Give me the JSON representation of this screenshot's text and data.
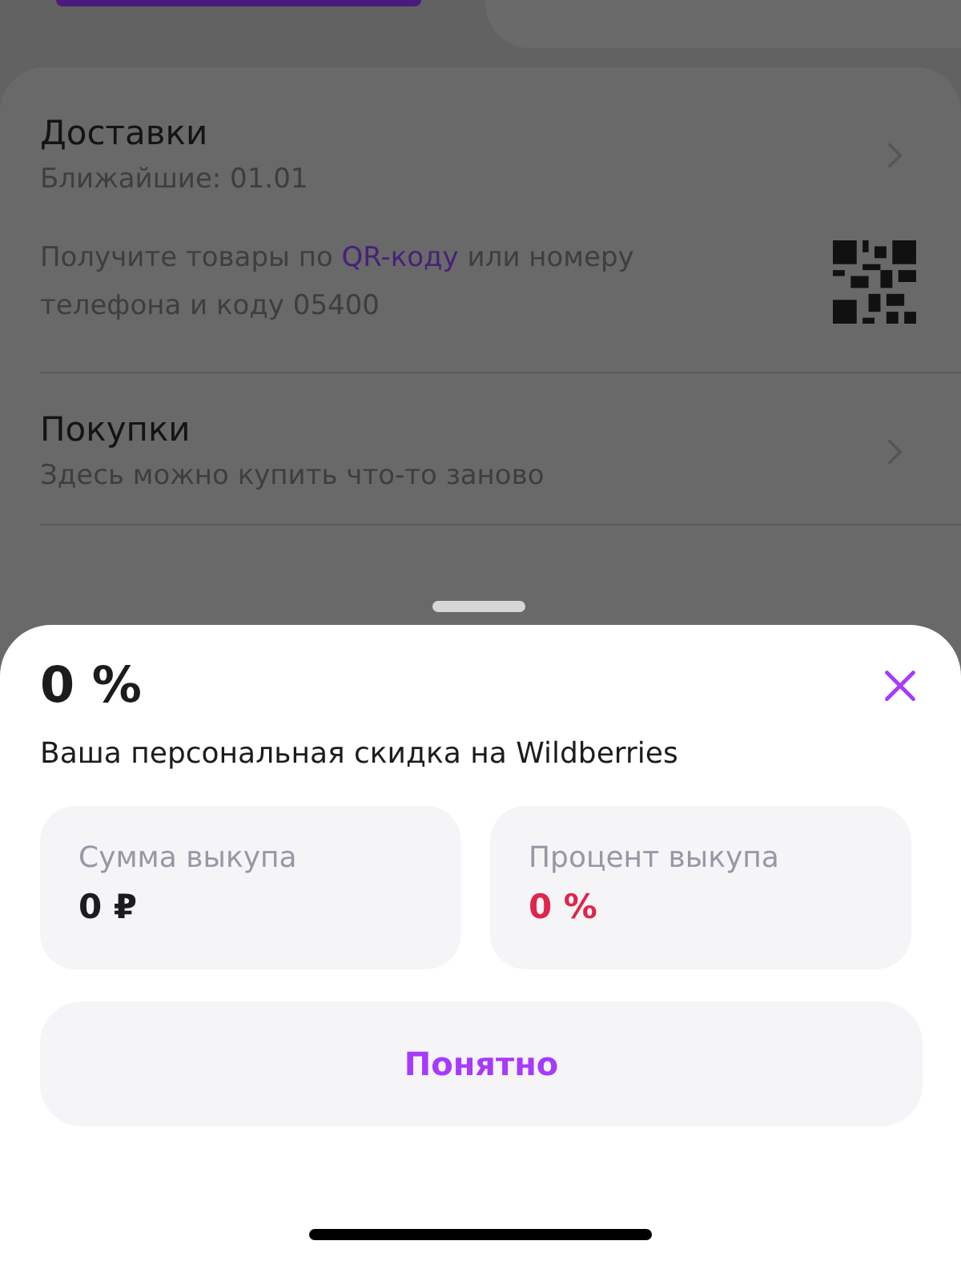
{
  "background": {
    "sections": [
      {
        "title": "Доставки",
        "subtitle": "Ближайшие: 01.01",
        "note": "Получите товары по **QR-коду** или номеру телефона и коду 05400"
      },
      {
        "title": "Покупки",
        "subtitle": "Здесь можно купить что-то заново"
      }
    ]
  },
  "sheet": {
    "title": "0 %",
    "description": "Ваша персональная скидка на Wildberries",
    "stats": [
      {
        "label": "Сумма выкупа",
        "value": "0 ₽",
        "color": "#1c1c1e"
      },
      {
        "label": "Процент выкупа",
        "value": "0 %",
        "color": "#e0244b"
      }
    ],
    "button": "Понятно"
  }
}
